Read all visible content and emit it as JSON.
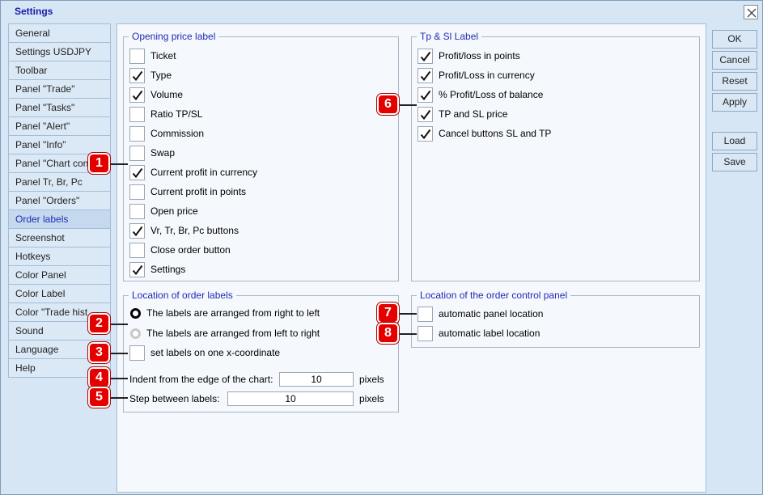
{
  "window": {
    "title": "Settings"
  },
  "sidebar": {
    "items": [
      {
        "label": "General"
      },
      {
        "label": "Settings USDJPY"
      },
      {
        "label": "Toolbar"
      },
      {
        "label": "Panel \"Trade\""
      },
      {
        "label": "Panel \"Tasks\""
      },
      {
        "label": "Panel \"Alert\""
      },
      {
        "label": "Panel \"Info\""
      },
      {
        "label": "Panel \"Chart con"
      },
      {
        "label": "Panel Tr, Br, Pc"
      },
      {
        "label": "Panel \"Orders\""
      },
      {
        "label": "Order labels"
      },
      {
        "label": "Screenshot"
      },
      {
        "label": "Hotkeys"
      },
      {
        "label": "Color Panel"
      },
      {
        "label": "Color Label"
      },
      {
        "label": "Color \"Trade hist"
      },
      {
        "label": "Sound"
      },
      {
        "label": "Language"
      },
      {
        "label": "Help"
      }
    ],
    "active": "Order labels"
  },
  "opening_price": {
    "title": "Opening price label",
    "items": [
      {
        "label": "Ticket",
        "checked": false
      },
      {
        "label": "Type",
        "checked": true
      },
      {
        "label": "Volume",
        "checked": true
      },
      {
        "label": "Ratio TP/SL",
        "checked": false
      },
      {
        "label": "Commission",
        "checked": false
      },
      {
        "label": "Swap",
        "checked": false
      },
      {
        "label": "Current profit in currency",
        "checked": true
      },
      {
        "label": "Current profit in points",
        "checked": false
      },
      {
        "label": "Open price",
        "checked": false
      },
      {
        "label": "Vr, Tr, Br, Pc buttons",
        "checked": true
      },
      {
        "label": "Close order button",
        "checked": false
      },
      {
        "label": "Settings",
        "checked": true
      }
    ]
  },
  "tp_sl": {
    "title": "Tp & Sl Label",
    "items": [
      {
        "label": "Profit/loss in points",
        "checked": true
      },
      {
        "label": "Profit/Loss in currency",
        "checked": true
      },
      {
        "label": "% Profit/Loss of balance",
        "checked": true
      },
      {
        "label": "TP and SL price",
        "checked": true
      },
      {
        "label": "Cancel buttons SL and TP",
        "checked": true
      }
    ]
  },
  "location": {
    "title": "Location of order labels",
    "radio_right_to_left": "The labels are arranged from right to left",
    "radio_left_to_right": "The labels are arranged from left to right",
    "one_x_label": "set labels on one x-coordinate",
    "indent_label": "Indent from the edge of the chart:",
    "indent_value": "10",
    "step_label": "Step between labels:",
    "step_value": "10",
    "units": "pixels"
  },
  "control_panel": {
    "title": "Location of the order control panel",
    "auto_panel": "automatic panel location",
    "auto_label": "automatic label location"
  },
  "buttons": {
    "ok": "OK",
    "cancel": "Cancel",
    "reset": "Reset",
    "apply": "Apply",
    "load": "Load",
    "save": "Save"
  },
  "callouts": [
    "1",
    "2",
    "3",
    "4",
    "5",
    "6",
    "7",
    "8"
  ],
  "icons": {
    "check": "checkmark-icon",
    "close": "close-icon"
  },
  "colors": {
    "accent": "#1f2bb5",
    "callout": "#e50000",
    "background": "#d6e6f5"
  }
}
